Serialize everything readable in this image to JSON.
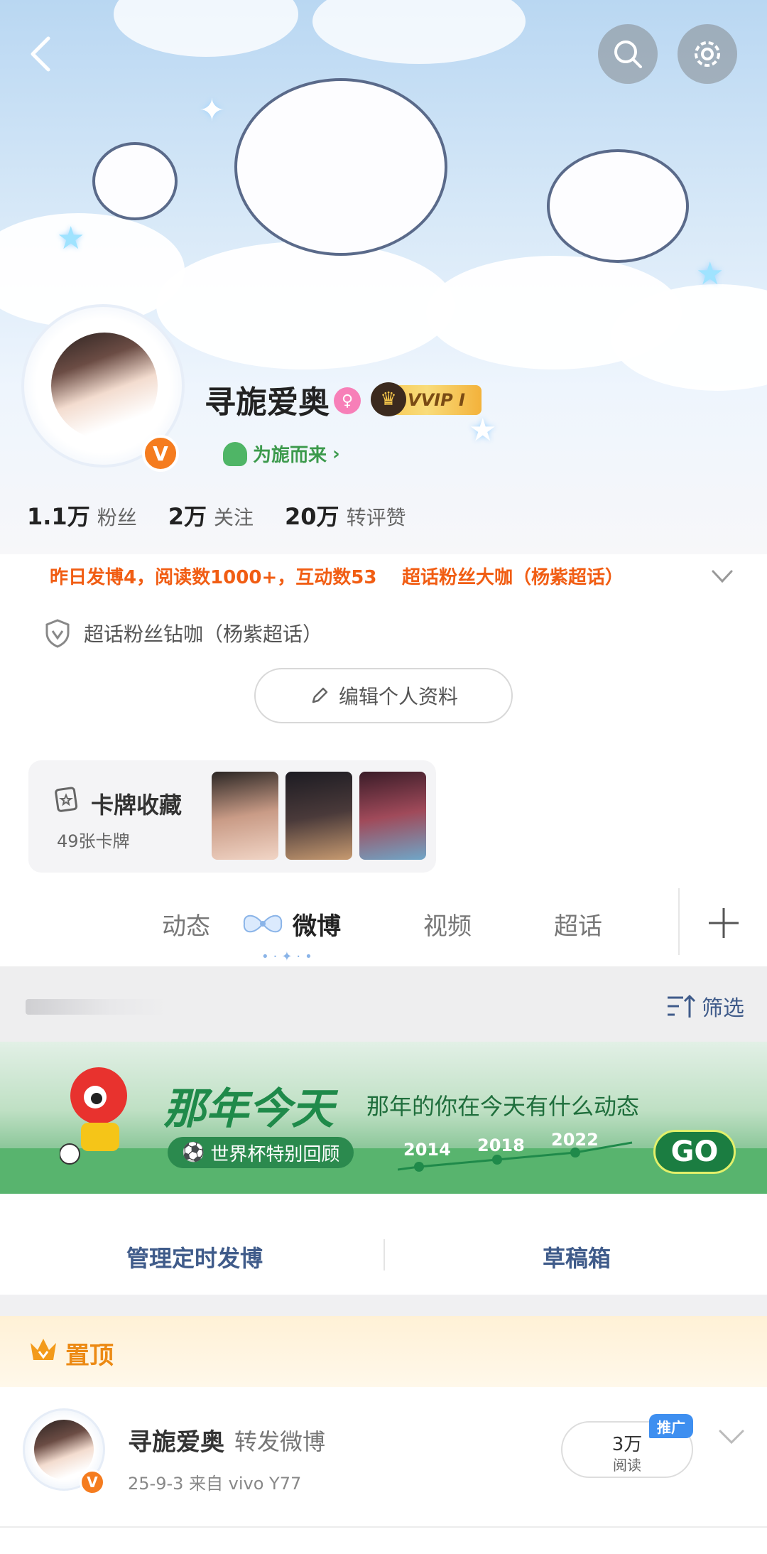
{
  "profile": {
    "name": "寻旎爱奥",
    "vip_label": "VVIP I",
    "fan_tag": "为旎而来",
    "fan_tag_chevron": "›",
    "verified_badge": "V",
    "gender_icon": "female-icon",
    "stats": [
      {
        "value": "1.1万",
        "label": "粉丝"
      },
      {
        "value": "2万",
        "label": "关注"
      },
      {
        "value": "20万",
        "label": "转评赞"
      }
    ],
    "honor_1": "昨日发博4，阅读数1000+，互动数53",
    "honor_2": "超话粉丝大咖（杨紫超话）",
    "badge_text": "超话粉丝钻咖（杨紫超话）",
    "edit_label": "编辑个人资料"
  },
  "cards": {
    "title": "卡牌收藏",
    "count": "49张卡牌"
  },
  "tabs": [
    {
      "label": "动态"
    },
    {
      "label": "微博",
      "active": true
    },
    {
      "label": "视频"
    },
    {
      "label": "超话"
    }
  ],
  "filter": {
    "label": "筛选"
  },
  "promo": {
    "title": "那年今天",
    "subtitle": "那年的你在今天有什么动态",
    "chip": "世界杯特别回顾",
    "years": [
      "2014",
      "2018",
      "2022"
    ],
    "go": "GO"
  },
  "manage": {
    "left": "管理定时发博",
    "right": "草稿箱"
  },
  "pinned": {
    "label": "置顶",
    "post_name": "寻旎爱奥",
    "post_action": "转发微博",
    "post_meta": "25-9-3   来自 vivo Y77",
    "read_num": "3万",
    "read_label": "阅读",
    "promo_tag": "推广"
  },
  "colors": {
    "accent_orange": "#f15d13",
    "link_blue": "#3f5b8a",
    "verified_orange": "#f57c1f",
    "promo_green": "#1f8a4a"
  }
}
